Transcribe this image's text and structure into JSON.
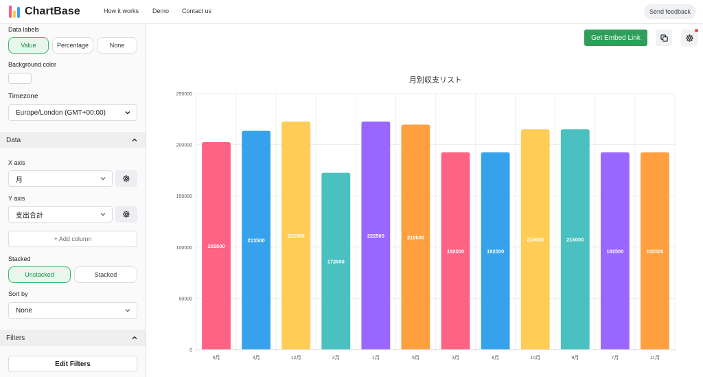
{
  "brand": {
    "name": "ChartBase",
    "mark_colors": [
      "#ff5c7c",
      "#ffcc4d",
      "#3aa0e8"
    ]
  },
  "nav": {
    "items": [
      "How it works",
      "Demo",
      "Contact us"
    ],
    "feedback": "Send feedback"
  },
  "sidebar": {
    "data_labels": {
      "label": "Data labels",
      "options": [
        "Value",
        "Percentage",
        "None"
      ],
      "selected": "Value"
    },
    "background": {
      "label": "Background color"
    },
    "timezone": {
      "label": "Timezone",
      "value": "Europe/London (GMT+00:00)"
    },
    "data_section": {
      "title": "Data"
    },
    "x_axis": {
      "label": "X axis",
      "value": "月"
    },
    "y_axis": {
      "label": "Y axis",
      "value": "支出合計"
    },
    "add_column": "+ Add column",
    "stacked": {
      "label": "Stacked",
      "options": [
        "Unstacked",
        "Stacked"
      ],
      "selected": "Unstacked"
    },
    "sort_by": {
      "label": "Sort by",
      "value": "None"
    },
    "filters_section": {
      "title": "Filters"
    },
    "edit_filters": "Edit Filters"
  },
  "toolbar": {
    "embed_label": "Get Embed Link",
    "copy_icon": "copy-icon",
    "settings_icon": "gear-icon"
  },
  "chart_data": {
    "type": "bar",
    "title": "月別収支リスト",
    "categories": [
      "6月",
      "4月",
      "12月",
      "2月",
      "1月",
      "5月",
      "3月",
      "8月",
      "10月",
      "9月",
      "7月",
      "11月"
    ],
    "values": [
      202500,
      213500,
      222500,
      172500,
      222500,
      219500,
      192500,
      192500,
      215000,
      215000,
      192500,
      192500
    ],
    "colors": [
      "#ff6384",
      "#36a2eb",
      "#ffcd56",
      "#4bc0c0",
      "#9966ff",
      "#ff9f40",
      "#ff6384",
      "#36a2eb",
      "#ffcd56",
      "#4bc0c0",
      "#9966ff",
      "#ff9f40"
    ],
    "ylim": [
      0,
      250000
    ],
    "yticks": [
      "0",
      "50000",
      "100000",
      "150000",
      "200000",
      "250000"
    ],
    "data_labels": "value",
    "grid": true,
    "legend": "none"
  }
}
